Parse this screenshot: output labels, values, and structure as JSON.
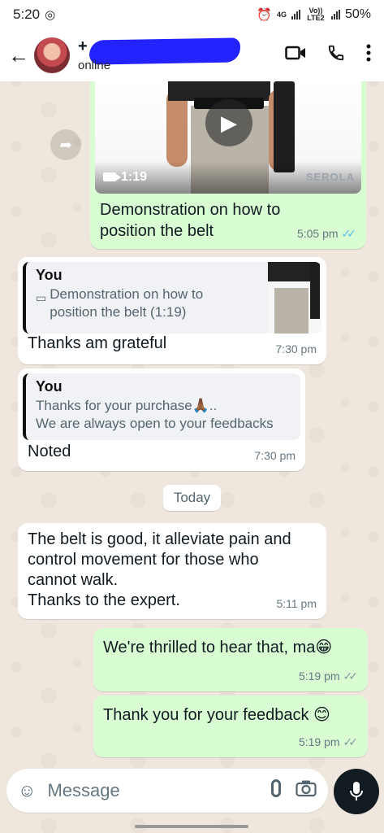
{
  "status_bar": {
    "time": "5:20",
    "network": "4G",
    "volte": "Vo)) LTE2",
    "battery": "50%"
  },
  "header": {
    "contact_prefix": "+",
    "contact_status": "online"
  },
  "messages": [
    {
      "id": "video",
      "caption": "Demonstration on how to position the belt",
      "duration": "1:19",
      "watermark": "SEROLA",
      "time": "5:05 pm"
    },
    {
      "id": "reply1",
      "quote_author": "You",
      "quote_text": "Demonstration on how to position the belt (1:19)",
      "text": "Thanks am grateful",
      "time": "7:30 pm"
    },
    {
      "id": "reply2",
      "quote_author": "You",
      "quote_text": "Thanks for your purchase🙏🏾..\nWe are always open to your feedbacks",
      "text": "Noted",
      "time": "7:30 pm"
    },
    {
      "id": "feedback",
      "text": "The belt is good, it alleviate pain and control movement for those who cannot walk.\nThanks to the expert.",
      "time": "5:11 pm"
    },
    {
      "id": "thrilled",
      "text": "We're thrilled to hear that, ma😁",
      "time": "5:19 pm"
    },
    {
      "id": "thanks",
      "text": "Thank you for your feedback 😊",
      "time": "5:19 pm"
    }
  ],
  "date_divider": "Today",
  "composer": {
    "placeholder": "Message"
  },
  "icons": {
    "back": "arrow-left-icon",
    "video_call": "video-call-icon",
    "call": "phone-icon",
    "menu": "more-vertical-icon",
    "forward": "forward-icon",
    "play": "play-icon",
    "emoji": "sticker-icon",
    "attach": "paperclip-icon",
    "camera": "camera-icon",
    "mic": "mic-icon"
  },
  "colors": {
    "outgoing": "#d9fdd3",
    "incoming": "#ffffff",
    "read_ticks": "#53bdeb",
    "sent_ticks": "#8696a0"
  }
}
